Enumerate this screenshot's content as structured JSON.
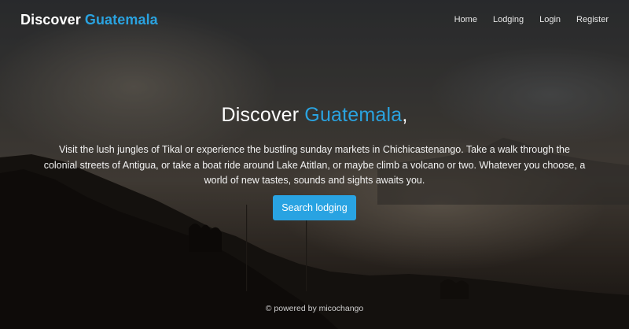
{
  "brand": {
    "word1": "Discover",
    "word2": "Guatemala"
  },
  "nav": {
    "items": [
      {
        "label": "Home"
      },
      {
        "label": "Lodging"
      },
      {
        "label": "Login"
      },
      {
        "label": "Register"
      }
    ]
  },
  "hero": {
    "title_word1": "Discover",
    "title_word2": "Guatemala",
    "title_comma": ",",
    "description": "Visit the lush jungles of Tikal or experience the bustling sunday markets in Chichicastenango. Take a walk through the colonial streets of Antigua, or take a boat ride around Lake Atitlan, or maybe climb a volcano or two. Whatever you choose, a world of new tastes, sounds and sights awaits you.",
    "cta_label": "Search lodging"
  },
  "footer": {
    "text": "© powered by micochango"
  },
  "colors": {
    "accent": "#2aa3e0",
    "button": "#29a3e2"
  }
}
